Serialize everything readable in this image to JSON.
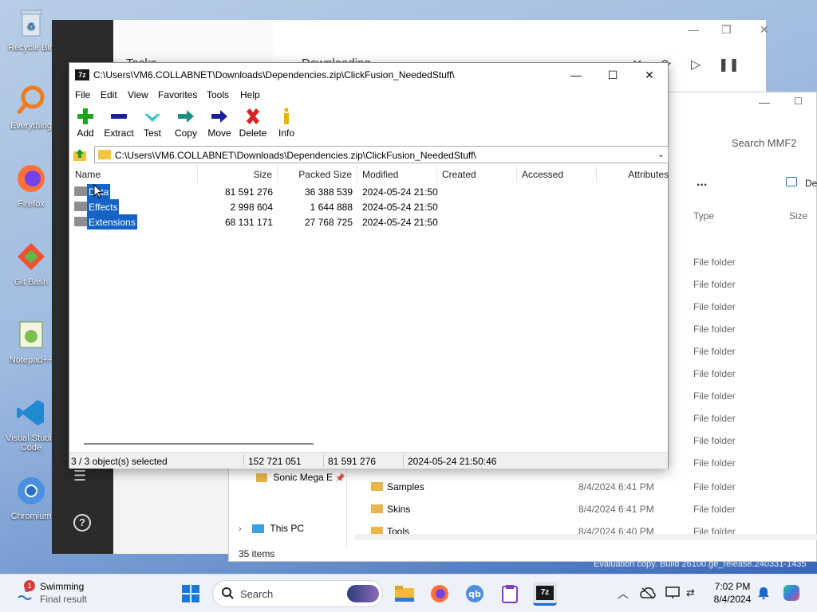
{
  "desktop": {
    "icons": [
      {
        "label": "Recycle Bin",
        "icon": "recycle-bin-icon"
      },
      {
        "label": "Everything",
        "icon": "everything-icon"
      },
      {
        "label": "Firefox",
        "icon": "firefox-icon"
      },
      {
        "label": "Git Bash",
        "icon": "git-bash-icon"
      },
      {
        "label": "Notepad++",
        "icon": "notepad-plus-icon"
      },
      {
        "label": "Visual Studio Code",
        "icon": "vscode-icon"
      },
      {
        "label": "Chromium",
        "icon": "chromium-icon"
      }
    ],
    "evaluation_text": "Evaluation copy. Build 26100.ge_release.240331-1435"
  },
  "downloader": {
    "tab_tasks": "Tasks",
    "tab_downloading": "Downloading"
  },
  "explorer": {
    "search_placeholder": "Search MMF2",
    "more_label": "...",
    "details_label": "De",
    "col_type": "Type",
    "col_size": "Size",
    "folder_type": "File folder",
    "nav_sonic": "Sonic Mega E",
    "nav_this_pc": "This PC",
    "rows": [
      {
        "name": "Samples",
        "date": "8/4/2024 6:41 PM",
        "type": "File folder"
      },
      {
        "name": "Skins",
        "date": "8/4/2024 6:41 PM",
        "type": "File folder"
      },
      {
        "name": "Tools",
        "date": "8/4/2024 6:40 PM",
        "type": "File folder"
      }
    ],
    "status_items": "35 items"
  },
  "sevenzip": {
    "title": "C:\\Users\\VM6.COLLABNET\\Downloads\\Dependencies.zip\\ClickFusion_NeededStuff\\",
    "menu": [
      "File",
      "Edit",
      "View",
      "Favorites",
      "Tools",
      "Help"
    ],
    "toolbar": [
      {
        "label": "Add",
        "icon": "add-icon"
      },
      {
        "label": "Extract",
        "icon": "extract-icon"
      },
      {
        "label": "Test",
        "icon": "test-icon"
      },
      {
        "label": "Copy",
        "icon": "copy-icon"
      },
      {
        "label": "Move",
        "icon": "move-icon"
      },
      {
        "label": "Delete",
        "icon": "delete-icon"
      },
      {
        "label": "Info",
        "icon": "info-icon"
      }
    ],
    "address": "C:\\Users\\VM6.COLLABNET\\Downloads\\Dependencies.zip\\ClickFusion_NeededStuff\\",
    "columns": [
      "Name",
      "Size",
      "Packed Size",
      "Modified",
      "Created",
      "Accessed",
      "Attributes"
    ],
    "rows": [
      {
        "name": "Data",
        "size": "81 591 276",
        "packed": "36 388 539",
        "modified": "2024-05-24 21:50"
      },
      {
        "name": "Effects",
        "size": "2 998 604",
        "packed": "1 644 888",
        "modified": "2024-05-24 21:50"
      },
      {
        "name": "Extensions",
        "size": "68 131 171",
        "packed": "27 768 725",
        "modified": "2024-05-24 21:50"
      }
    ],
    "status": {
      "selected": "3 / 3 object(s) selected",
      "size": "152 721 051",
      "packed": "81 591 276",
      "modified": "2024-05-24 21:50:46"
    }
  },
  "taskbar": {
    "weather_title": "Swimming",
    "weather_sub": "Final result",
    "weather_badge": "1",
    "search_label": "Search",
    "time": "7:02 PM",
    "date": "8/4/2024"
  }
}
